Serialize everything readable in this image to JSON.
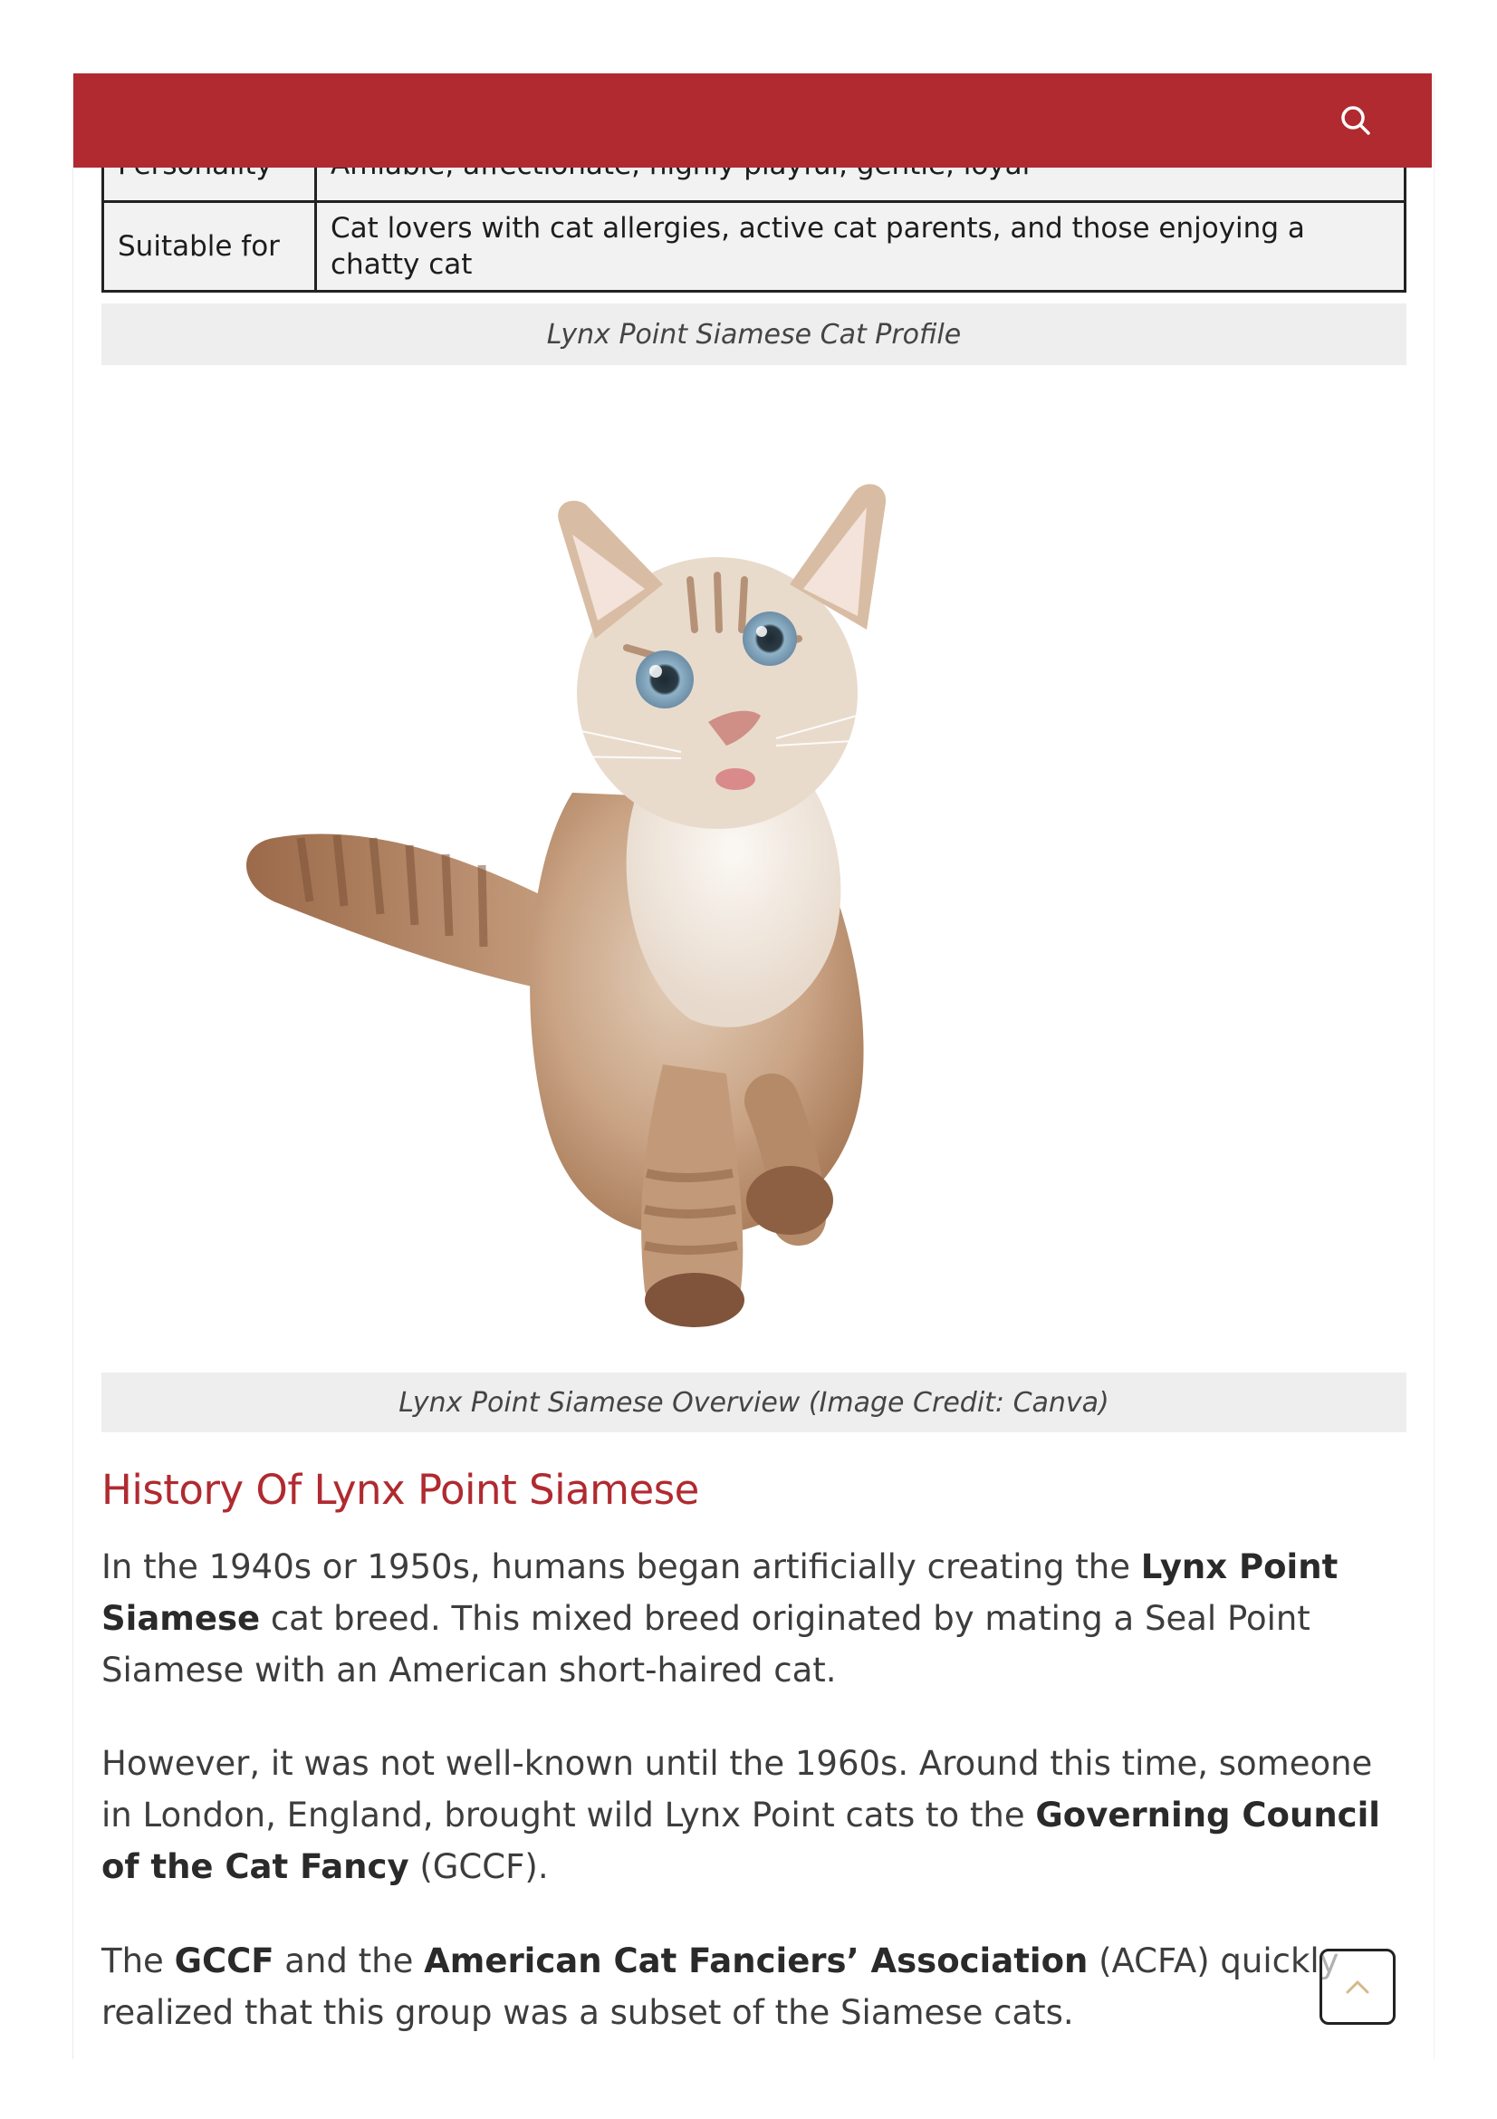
{
  "header": {
    "search_icon": "search-icon",
    "brand_color": "#b02a30"
  },
  "profile_table": {
    "rows": [
      {
        "label": "Personality",
        "value": "Amiable, affectionate, highly playful, gentle, loyal"
      },
      {
        "label": "Suitable for",
        "value": "Cat lovers with cat allergies, active cat parents, and those enjoying a chatty cat"
      }
    ],
    "caption": "Lynx Point Siamese Cat Profile"
  },
  "figure": {
    "caption": "Lynx Point Siamese Overview (Image Credit: Canva)"
  },
  "history": {
    "heading": "History Of Lynx Point Siamese",
    "p1": {
      "before": "In the 1940s or 1950s, humans began artificially creating the ",
      "bold": "Lynx Point Siamese",
      "after": " cat breed. This mixed breed originated by mating a Seal Point Siamese with an American short-haired cat."
    },
    "p2": {
      "before": "However, it was not well-known until the 1960s. Around this time, someone in London, England, brought wild Lynx Point cats to the ",
      "bold": "Governing Council of the Cat Fancy",
      "after": " (GCCF)."
    },
    "p3": {
      "t1": "The ",
      "b1": "GCCF",
      "t2": " and the ",
      "b2": "American Cat Fanciers’ Association",
      "t3": " (ACFA) quickly realized that this group was a subset of the Siamese cats."
    }
  },
  "back_to_top": {
    "icon": "chevron-up-icon",
    "accent": "#d4b98a"
  }
}
